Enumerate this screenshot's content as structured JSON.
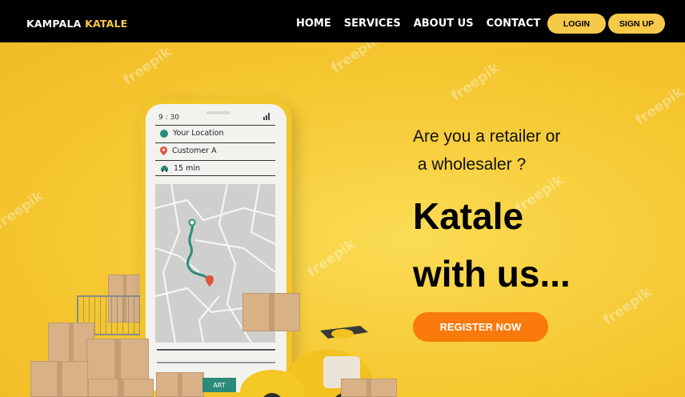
{
  "nav": {
    "brand_part1": "KAMPALA",
    "brand_part2": "KATALE",
    "links": [
      "HOME",
      "SERVICES",
      "ABOUT US",
      "CONTACT"
    ],
    "login_label": "LOGIN",
    "signup_label": "SIGN UP"
  },
  "phone": {
    "time": "9 : 30",
    "rows": [
      "Your Location",
      "Customer A",
      "15 min"
    ],
    "start_label": "ART"
  },
  "watermark": "freepik",
  "hero": {
    "question_line1": "Are you a retailer or",
    "question_line2": " a wholesaler ?",
    "headline_line1": "Katale",
    "headline_line2": "with us...",
    "cta_label": "REGISTER NOW"
  },
  "colors": {
    "navbar": "#000000",
    "accent_yellow": "#f7c948",
    "hero_bg": "#f5c832",
    "cta_orange": "#f97a0b",
    "route_teal": "#2a8c7a"
  }
}
